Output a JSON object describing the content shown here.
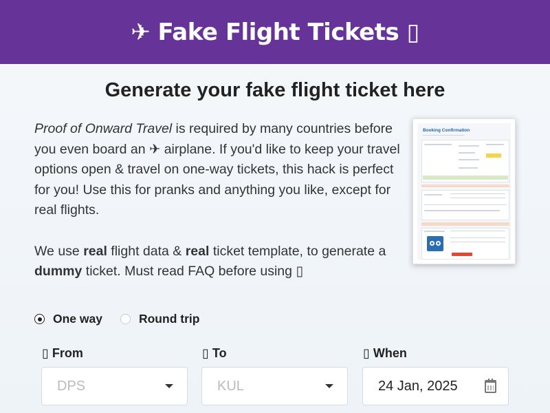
{
  "header": {
    "brand": "✈ Fake Flight Tickets ▯"
  },
  "main": {
    "headline": "Generate your fake flight ticket here",
    "intro": {
      "emphasis": "Proof of Onward Travel",
      "p1_rest": " is required by many countries before you even board an ✈ airplane. If you'd like to keep your travel options open & travel on one-way tickets, this hack is perfect for you! Use this for pranks and anything you like, except for real flights.",
      "p2_a": "We use ",
      "p2_b": "real",
      "p2_c": " flight data & ",
      "p2_d": "real",
      "p2_e": " ticket template, to generate a ",
      "p2_f": "dummy",
      "p2_g": " ticket. Must read FAQ before using ▯"
    },
    "preview": {
      "title": "Booking Confirmation"
    }
  },
  "form": {
    "trip_types": [
      {
        "label": "One way",
        "checked": true
      },
      {
        "label": "Round trip",
        "checked": false
      }
    ],
    "from": {
      "label": "▯ From",
      "placeholder": "DPS"
    },
    "to": {
      "label": "▯ To",
      "placeholder": "KUL"
    },
    "when": {
      "label": "▯ When",
      "value": "24 Jan, 2025"
    }
  },
  "colors": {
    "header_bg": "#663399",
    "accent": "#1c66b3"
  }
}
